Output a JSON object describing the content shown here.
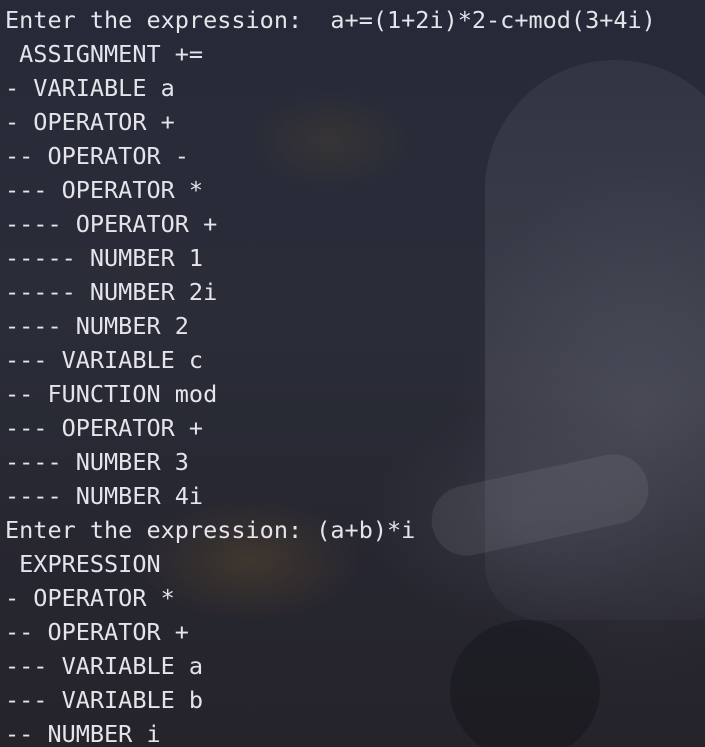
{
  "terminal": {
    "lines": [
      "Enter the expression:  a+=(1+2i)*2-c+mod(3+4i)",
      " ASSIGNMENT +=",
      "- VARIABLE a",
      "- OPERATOR +",
      "-- OPERATOR -",
      "--- OPERATOR *",
      "---- OPERATOR +",
      "----- NUMBER 1",
      "----- NUMBER 2i",
      "---- NUMBER 2",
      "--- VARIABLE c",
      "-- FUNCTION mod",
      "--- OPERATOR +",
      "---- NUMBER 3",
      "---- NUMBER 4i",
      "Enter the expression: (a+b)*i",
      " EXPRESSION",
      "- OPERATOR *",
      "-- OPERATOR +",
      "--- VARIABLE a",
      "--- VARIABLE b",
      "-- NUMBER i"
    ]
  },
  "colors": {
    "text": "#e4e4ea",
    "background": "#272a35"
  }
}
